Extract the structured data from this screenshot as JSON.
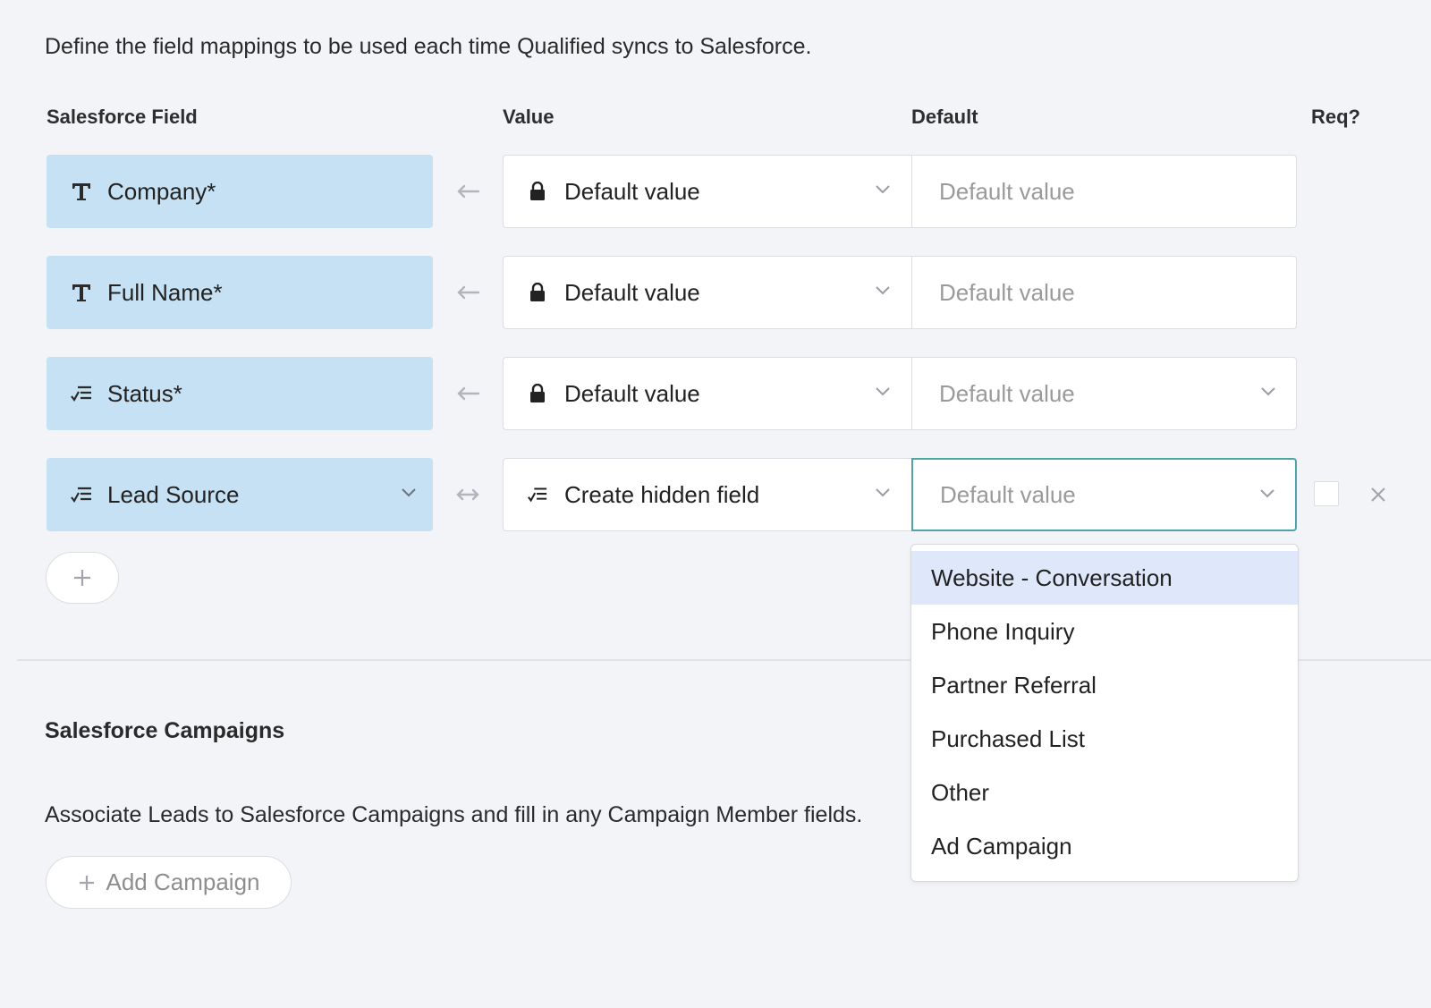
{
  "intro": "Define the field mappings to be used each time Qualified syncs to Salesforce.",
  "columns": {
    "sf_field": "Salesforce Field",
    "value": "Value",
    "default": "Default",
    "req": "Req?"
  },
  "rows": [
    {
      "field": "Company*",
      "field_icon": "text-type-icon",
      "arrow": "←",
      "value": "Default value",
      "value_icon": "lock-icon",
      "default_placeholder": "Default value"
    },
    {
      "field": "Full Name*",
      "field_icon": "text-type-icon",
      "arrow": "←",
      "value": "Default value",
      "value_icon": "lock-icon",
      "default_placeholder": "Default value"
    },
    {
      "field": "Status*",
      "field_icon": "picklist-icon",
      "arrow": "←",
      "value": "Default value",
      "value_icon": "lock-icon",
      "default_placeholder": "Default value"
    },
    {
      "field": "Lead Source",
      "field_icon": "picklist-icon",
      "arrow": "↔",
      "value": "Create hidden field",
      "value_icon": "picklist-icon",
      "default_placeholder": "Default value",
      "required_checked": false
    }
  ],
  "dropdown_options": [
    "Website - Conversation",
    "Phone Inquiry",
    "Partner Referral",
    "Purchased List",
    "Other",
    "Ad Campaign"
  ],
  "dropdown_highlighted": "Website - Conversation",
  "campaigns": {
    "title": "Salesforce Campaigns",
    "description": "Associate Leads to Salesforce Campaigns and fill in any Campaign Member fields.",
    "add_label": "Add Campaign"
  },
  "colors": {
    "field_bg": "#c5e1f3",
    "focus_border": "#4fa4a8",
    "highlight": "#dfe8fb",
    "page_bg": "#f3f4f8"
  }
}
